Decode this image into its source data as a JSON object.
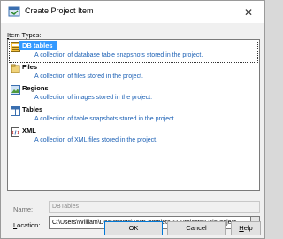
{
  "window": {
    "title": "Create Project Item",
    "close_glyph": "✕"
  },
  "item_types_label_prefix": "",
  "item_types_label_accel": "I",
  "item_types_label_rest": "tem Types:",
  "items": [
    {
      "name": "DB tables",
      "description": "A collection of database table snapshots stored in the project.",
      "icon": "db-tables-icon",
      "selected": true
    },
    {
      "name": "Files",
      "description": "A collection of files stored in the project.",
      "icon": "files-icon",
      "selected": false
    },
    {
      "name": "Regions",
      "description": "A collection of images stored in the project.",
      "icon": "regions-icon",
      "selected": false
    },
    {
      "name": "Tables",
      "description": "A collection of table snapshots stored in the project.",
      "icon": "tables-icon",
      "selected": false
    },
    {
      "name": "XML",
      "description": "A collection of XML files stored in the project.",
      "icon": "xml-icon",
      "selected": false
    }
  ],
  "name_label": "Name:",
  "name_value": "DBTables",
  "location_label_accel": "L",
  "location_label_rest": "ocation:",
  "location_value": "C:\\Users\\William\\Documents\\TestComplete 11 Projects\\CalcProject",
  "browse_label": "...",
  "buttons": {
    "ok": "OK",
    "cancel": "Cancel",
    "help_accel": "H",
    "help_rest": "elp"
  }
}
